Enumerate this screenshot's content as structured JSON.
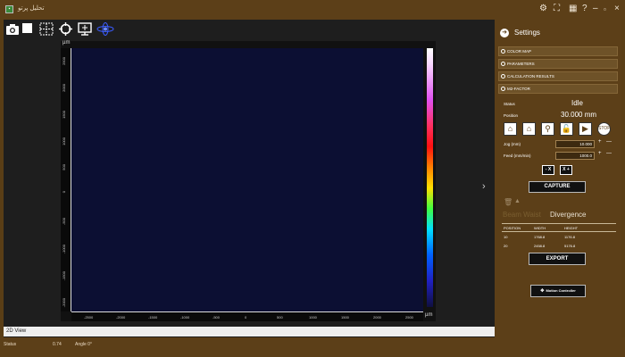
{
  "window": {
    "title": "تحليل پرتو",
    "logo": "app-logo",
    "controls": [
      "gear-icon",
      "fullscreen-icon",
      "grid-icon",
      "help-icon",
      "minimize-icon",
      "maximize-icon",
      "close-icon"
    ]
  },
  "toolbar": {
    "icons": [
      "camera-icon",
      "stop-icon",
      "roi-select-icon",
      "crosshair-icon",
      "monitor-icon",
      "beam-profile-icon"
    ]
  },
  "plot": {
    "unit_top": "µm",
    "unit_bottom": "µm",
    "x_ticks": [
      "-2500",
      "-2000",
      "-1500",
      "-1000",
      "-500",
      "0",
      "500",
      "1000",
      "1500",
      "2000",
      "2500"
    ],
    "y_ticks": [
      "2500",
      "2000",
      "1500",
      "1000",
      "500",
      "0",
      "-500",
      "-1000",
      "-1500",
      "-2000"
    ],
    "colormap": "rainbow",
    "background": "#0c0f33"
  },
  "view": {
    "label": "2D View"
  },
  "statusbar": {
    "status_label": "Status",
    "value": "0.74",
    "angle": "Angle 0°"
  },
  "settings": {
    "title": "Settings",
    "sections": [
      "COLOR MAP",
      "PARAMETERS",
      "CALCULATION RESULTS",
      "M2-FACTOR"
    ],
    "status_label": "Status",
    "status_value": "Idle",
    "position_label": "Position",
    "position_value": "30.000 mm",
    "jog_label": "Jog (mm)",
    "jog_value": "10.000",
    "feed_label": "Feed (mm/min)",
    "feed_value": "1000.0",
    "minus_x": "- X",
    "plus_x": "X +",
    "capture": "CAPTURE",
    "tab_beam_waist": "Beam Waist",
    "tab_divergence": "Divergence",
    "table": {
      "headers": [
        "POSITION",
        "WIDTH",
        "HEIGHT"
      ],
      "rows": [
        [
          "10",
          "1768.8",
          "1176.8"
        ],
        [
          "20",
          "2458.8",
          "5176.8"
        ]
      ]
    },
    "export": "EXPORT",
    "motion": "Motion Controller"
  }
}
